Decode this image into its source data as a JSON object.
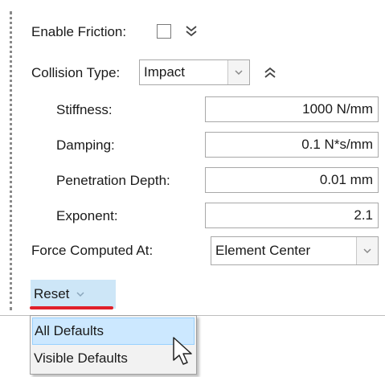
{
  "friction": {
    "label": "Enable Friction:",
    "checked": false
  },
  "collision": {
    "label": "Collision Type:",
    "value": "Impact"
  },
  "params": [
    {
      "label": "Stiffness:",
      "value": "1000 N/mm"
    },
    {
      "label": "Damping:",
      "value": "0.1 N*s/mm"
    },
    {
      "label": "Penetration Depth:",
      "value": "0.01 mm"
    },
    {
      "label": "Exponent:",
      "value": "2.1"
    }
  ],
  "force": {
    "label": "Force Computed At:",
    "value": "Element Center"
  },
  "reset": {
    "label": "Reset"
  },
  "menu": {
    "items": [
      {
        "label": "All Defaults"
      },
      {
        "label": "Visible Defaults"
      }
    ]
  },
  "colors": {
    "accent_underline": "#e0202a",
    "button_highlight": "#cde6f7",
    "menu_hover": "#cce8ff"
  }
}
